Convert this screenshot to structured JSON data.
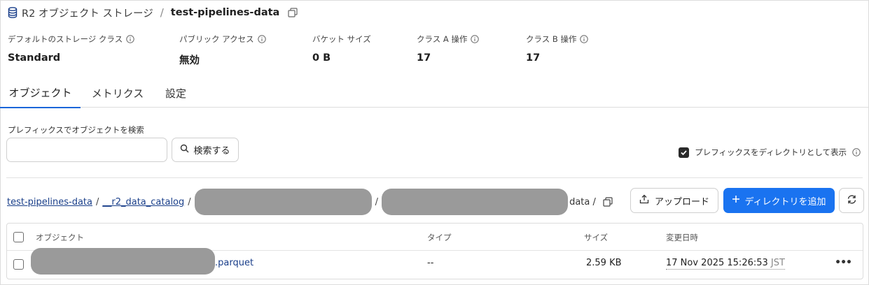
{
  "header": {
    "breadcrumb_root": "R2 オブジェクト ストレージ",
    "separator": "/",
    "bucket_name": "test-pipelines-data"
  },
  "stats": [
    {
      "label": "デフォルトのストレージ クラス",
      "value": "Standard"
    },
    {
      "label": "パブリック アクセス",
      "value": "無効"
    },
    {
      "label": "バケット サイズ",
      "value": "0 B"
    },
    {
      "label": "クラス A 操作",
      "value": "17"
    },
    {
      "label": "クラス B 操作",
      "value": "17"
    }
  ],
  "tabs": [
    {
      "label": "オブジェクト",
      "active": true
    },
    {
      "label": "メトリクス",
      "active": false
    },
    {
      "label": "設定",
      "active": false
    }
  ],
  "search": {
    "label": "プレフィックスでオブジェクトを検索",
    "value": "",
    "placeholder": "",
    "button_label": "検索する"
  },
  "directory_toggle": {
    "label": "プレフィックスをディレクトリとして表示",
    "checked": true
  },
  "path": {
    "root": "test-pipelines-data",
    "segment1": "__r2_data_catalog",
    "sep": "/",
    "tail": "data /"
  },
  "actions": {
    "upload_label": "アップロード",
    "add_directory_label": "ディレクトリを追加"
  },
  "table": {
    "columns": [
      "オブジェクト",
      "タイプ",
      "サイズ",
      "変更日時"
    ],
    "rows": [
      {
        "name_suffix": ".parquet",
        "type": "--",
        "size": "2.59 KB",
        "modified": "17 Nov 2025 15:26:53",
        "tz": "JST"
      }
    ]
  },
  "colors": {
    "accent": "#1a73f0",
    "link": "#1a3f8a",
    "tab_underline": "#1a66d9",
    "redaction": "#9a9a9a"
  },
  "icons": [
    "database-icon",
    "copy-icon",
    "info-icon",
    "search-icon",
    "check-icon",
    "upload-icon",
    "plus-icon",
    "refresh-icon",
    "more-icon"
  ]
}
